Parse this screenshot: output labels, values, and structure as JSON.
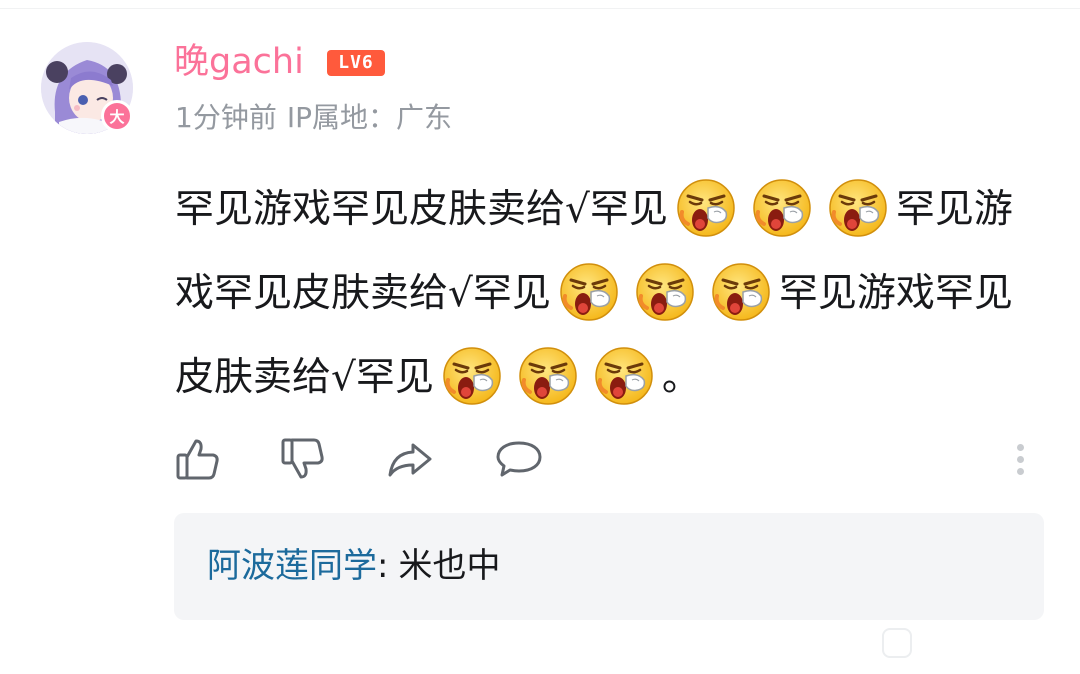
{
  "comment": {
    "avatar_badge": "大",
    "username": "晚gachi",
    "level": "LV6",
    "time": "1分钟前",
    "ip_location": "IP属地：广东",
    "content": {
      "segments": [
        {
          "type": "text",
          "value": "罕见游戏罕见皮肤卖给√罕见"
        },
        {
          "type": "emoji",
          "name": "angry-shout-emoji"
        },
        {
          "type": "emoji",
          "name": "angry-shout-emoji"
        },
        {
          "type": "emoji",
          "name": "angry-shout-emoji"
        },
        {
          "type": "text",
          "value": "罕见游戏罕见皮肤卖给√罕见"
        },
        {
          "type": "emoji",
          "name": "angry-shout-emoji"
        },
        {
          "type": "emoji",
          "name": "angry-shout-emoji"
        },
        {
          "type": "emoji",
          "name": "angry-shout-emoji"
        },
        {
          "type": "text",
          "value": "罕见游戏罕见皮肤卖给√罕见"
        },
        {
          "type": "emoji",
          "name": "angry-shout-emoji"
        },
        {
          "type": "emoji",
          "name": "angry-shout-emoji"
        },
        {
          "type": "emoji",
          "name": "angry-shout-emoji"
        },
        {
          "type": "text",
          "value": "。"
        }
      ]
    }
  },
  "actions": {
    "like_icon": "thumbs-up-icon",
    "dislike_icon": "thumbs-down-icon",
    "share_icon": "share-arrow-icon",
    "reply_icon": "speech-bubble-icon",
    "more_icon": "more-vertical-icon"
  },
  "reply_preview": {
    "user": "阿波莲同学",
    "separator": ":",
    "text": "米也中"
  },
  "colors": {
    "username": "#fb7299",
    "level_badge": "#ff5a3c",
    "reply_user": "#1c6a9c",
    "meta_text": "#9499a0"
  }
}
